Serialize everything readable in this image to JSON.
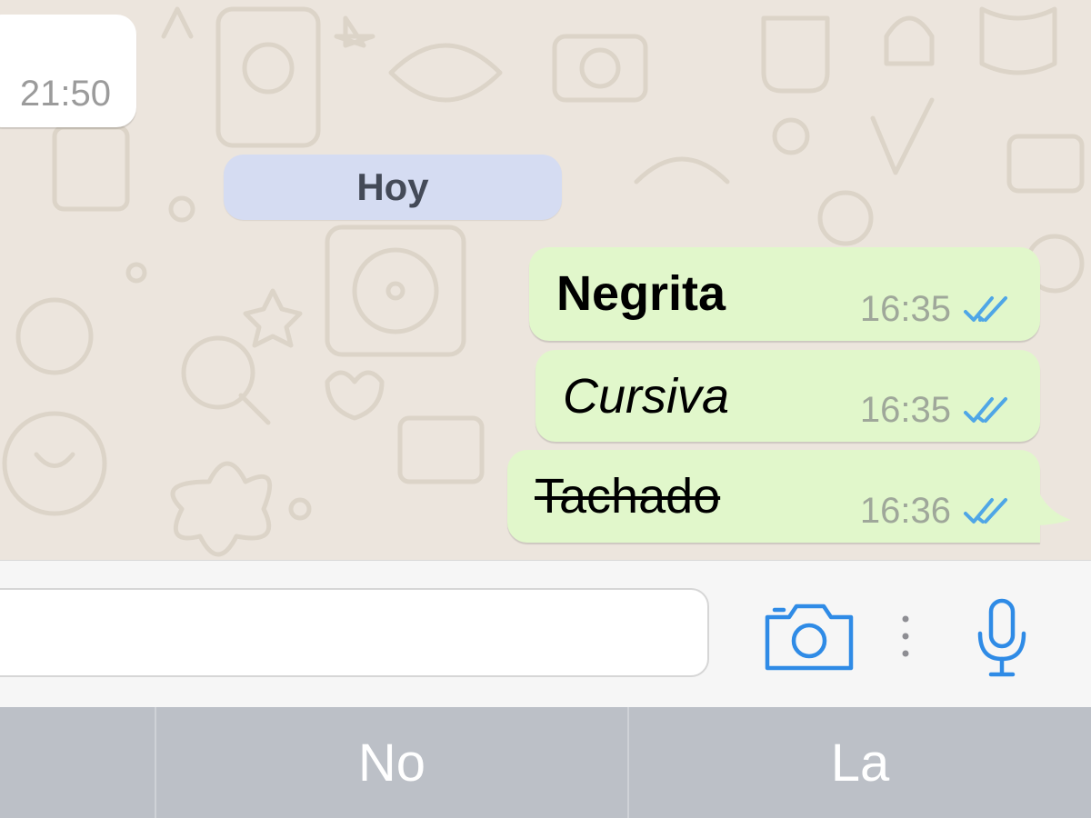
{
  "chat": {
    "incoming": {
      "time": "21:50"
    },
    "date_divider": "Hoy",
    "messages": [
      {
        "text": "Negrita",
        "style": "bold",
        "time": "16:35",
        "status": "read"
      },
      {
        "text": "Cursiva",
        "style": "italic",
        "time": "16:35",
        "status": "read"
      },
      {
        "text": "Tachado",
        "style": "strikethrough",
        "time": "16:36",
        "status": "read"
      }
    ]
  },
  "input_bar": {
    "placeholder": "",
    "icons": [
      "camera-icon",
      "more-dots-icon",
      "microphone-icon"
    ]
  },
  "keyboard": {
    "suggestions": [
      "",
      "No",
      "La"
    ]
  },
  "colors": {
    "chat_background": "#ece5dd",
    "outgoing_bubble": "#e1f7cb",
    "date_pill": "#d5dcf2",
    "read_ticks": "#4fa6e6",
    "accent_icons": "#2f8be6",
    "keyboard_suggestion_bar": "#bcc0c7"
  }
}
